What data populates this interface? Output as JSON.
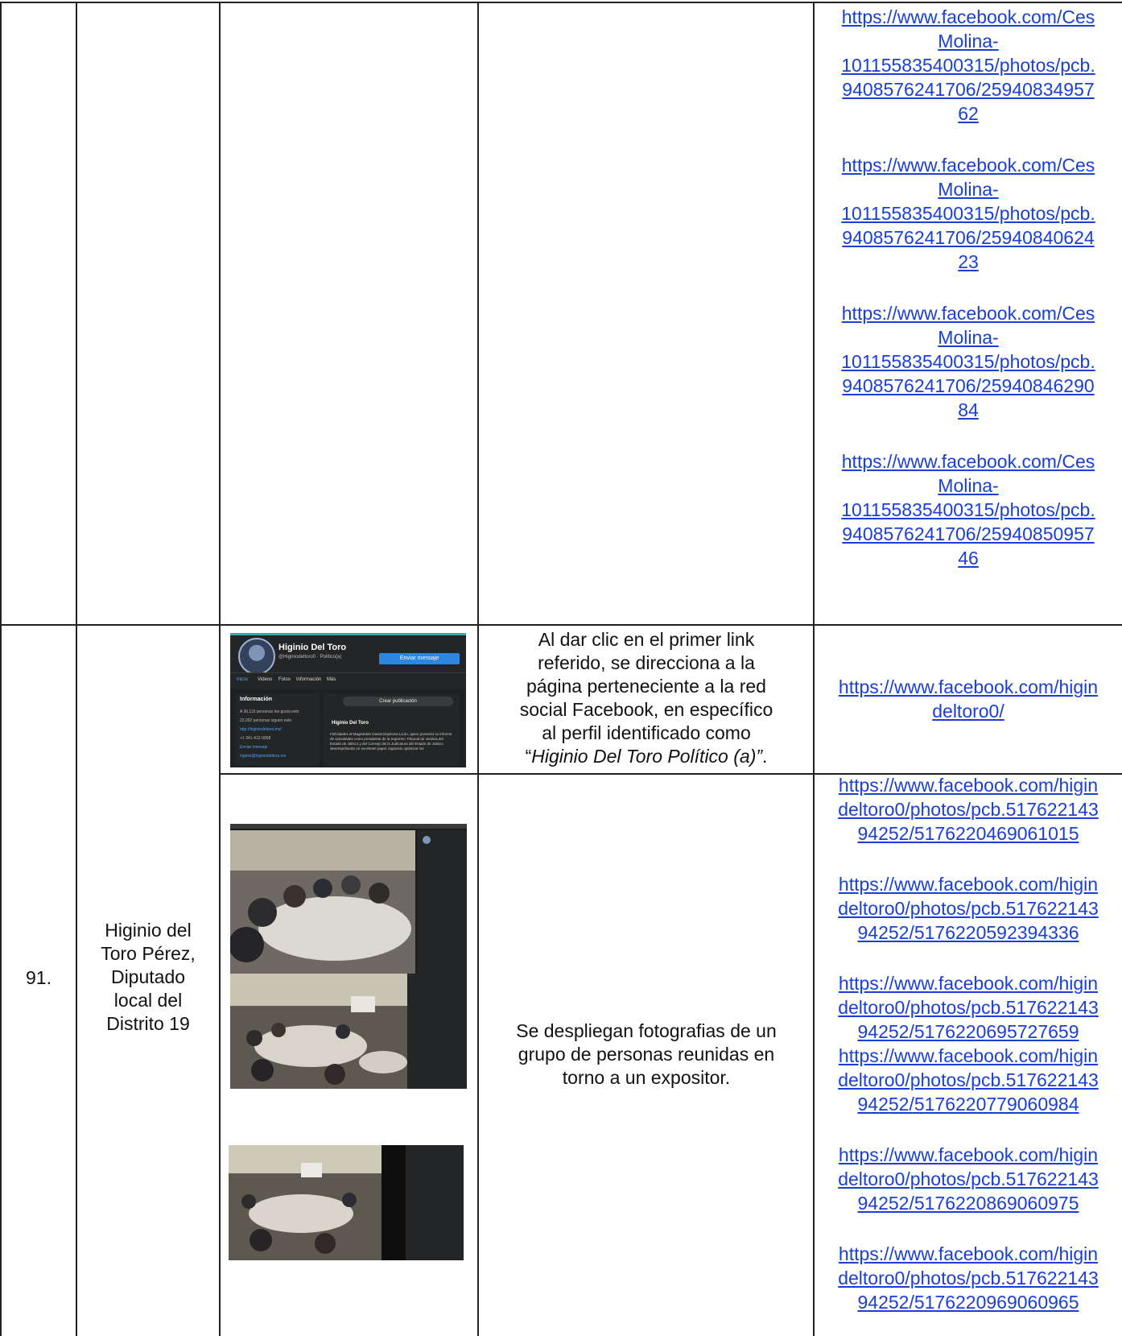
{
  "row_top": {
    "links": [
      "https://www.facebook.com/Ces\nMolina-\n101155835400315/photos/pcb.\n9408576241706/25940834957\n62",
      "https://www.facebook.com/Ces\nMolina-\n101155835400315/photos/pcb.\n9408576241706/25940840624\n23",
      "https://www.facebook.com/Ces\nMolina-\n101155835400315/photos/pcb.\n9408576241706/25940846290\n84",
      "https://www.facebook.com/Ces\nMolina-\n101155835400315/photos/pcb.\n9408576241706/25940850957\n46"
    ]
  },
  "row_91": {
    "number": "91.",
    "subject": "Higinio del\nToro Pérez,\nDiputado\nlocal del\nDistrito 19",
    "fb_profile": {
      "name": "Higinio Del Toro",
      "handle": "@Higiniodeltoro0 · Político(a)",
      "button": "Enviar mensaje",
      "tabs": [
        "Inicio",
        "Videos",
        "Fotos",
        "Información",
        "Más"
      ],
      "info_title": "Información",
      "info_rows": [
        "A 36,119 personas les gusta esto",
        "22,052 personas siguen esto",
        "http://higiniodeltoro.mx/",
        "+1 341-412-9058",
        "Enviar mensaje",
        "higinio@higiniodeltoro.mx"
      ],
      "create_post": "Crear publicación",
      "post_name": "Higinio Del Toro",
      "post_text": "Felicidades al Magistrado Daniel Espinosa Licón, quien presentó su informe de actividades como presidente de la Supremo Tribunal de Justicia del Estado de Jalisco y del Consejo de la Judicatura del Estado de Jalisco desempeñando un excelente papel, logrando optimizar los"
    },
    "desc_1_pre": "Al dar clic en el primer link\nreferido, se direcciona a la\npágina perteneciente a la red\nsocial Facebook, en específico\nal perfil identificado como\n“",
    "desc_1_italic": "Higinio Del Toro Político (a)”",
    "desc_1_post": ".",
    "link_1": "https://www.facebook.com/higin\ndeltoro0/",
    "desc_2": "Se despliegan fotografias de un\ngrupo de personas reunidas en\ntorno a un expositor.",
    "links_2": [
      "https://www.facebook.com/higin\ndeltoro0/photos/pcb.517622143\n94252/5176220469061015",
      "https://www.facebook.com/higin\ndeltoro0/photos/pcb.517622143\n94252/5176220592394336",
      "https://www.facebook.com/higin\ndeltoro0/photos/pcb.517622143\n94252/5176220695727659",
      "https://www.facebook.com/higin\ndeltoro0/photos/pcb.517622143\n94252/5176220779060984",
      "https://www.facebook.com/higin\ndeltoro0/photos/pcb.517622143\n94252/5176220869060975",
      "https://www.facebook.com/higin\ndeltoro0/photos/pcb.517622143\n94252/5176220969060965"
    ]
  }
}
